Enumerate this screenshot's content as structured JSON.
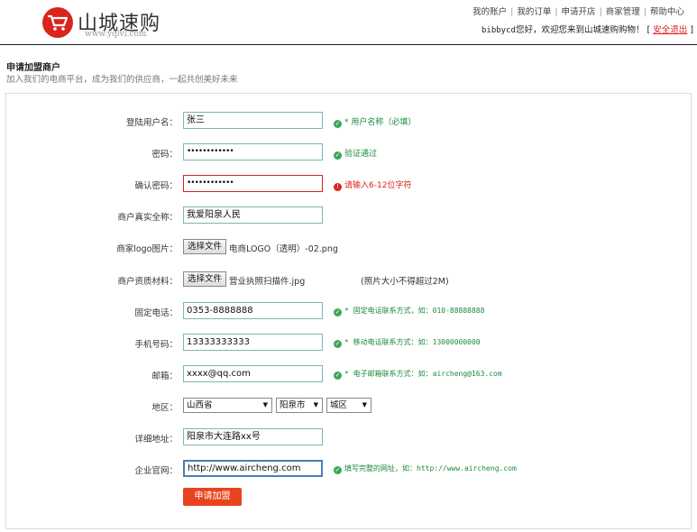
{
  "brand": {
    "name": "山城速购",
    "url": "www.yqlvl.com",
    "badge_color": "#d9251c"
  },
  "top_nav": {
    "items": [
      "我的账户",
      "我的订单",
      "申请开店",
      "商家管理",
      "帮助中心"
    ],
    "welcome_user": "bibbycd",
    "welcome_text": "您好，欢迎您来到山城速购购物！",
    "logout_open": "[",
    "logout_label": "安全退出",
    "logout_close": "]"
  },
  "page": {
    "title": "申请加盟商户",
    "subtitle": "加入我们的电商平台，成为我们的供应商，一起共创美好未来"
  },
  "form": {
    "username": {
      "label": "登陆用户名：",
      "value": "张三",
      "tip": "* 用户名称（必填）"
    },
    "password": {
      "label": "密码：",
      "value": "••••••••••••",
      "tip": "验证通过"
    },
    "confirm_password": {
      "label": "确认密码：",
      "value": "••••••••••••",
      "tip": "请输入6-12位字符"
    },
    "real_name": {
      "label": "商户真实全称：",
      "value": "我爱阳泉人民"
    },
    "logo": {
      "label": "商家logo图片：",
      "button": "选择文件",
      "file": "电商LOGO（透明）-02.png"
    },
    "license": {
      "label": "商户资质材料：",
      "button": "选择文件",
      "file": "营业执照扫描件.jpg",
      "note": "(照片大小不得超过2M)"
    },
    "phone": {
      "label": "固定电话：",
      "value": "0353-8888888",
      "tip": "* 固定电话联系方式，如：010-88888888"
    },
    "mobile": {
      "label": "手机号码：",
      "value": "13333333333",
      "tip": "* 移动电话联系方式：如：13000000000"
    },
    "email": {
      "label": "邮箱：",
      "value": "xxxx@qq.com",
      "tip": "* 电子邮箱联系方式：如：aircheng@163.com"
    },
    "region": {
      "label": "地区：",
      "province": "山西省",
      "city": "阳泉市",
      "district": "城区"
    },
    "address": {
      "label": "详细地址：",
      "value": "阳泉市大连路xx号"
    },
    "website": {
      "label": "企业官网：",
      "value": "http://www.aircheng.com",
      "tip": "填写完整的网址，如：http://www.aircheng.com"
    },
    "submit_label": "申请加盟"
  },
  "colors": {
    "accent": "#e8431f",
    "ok": "#1c8a3c",
    "error": "#d9251c",
    "field_border": "#7ab8b0"
  }
}
